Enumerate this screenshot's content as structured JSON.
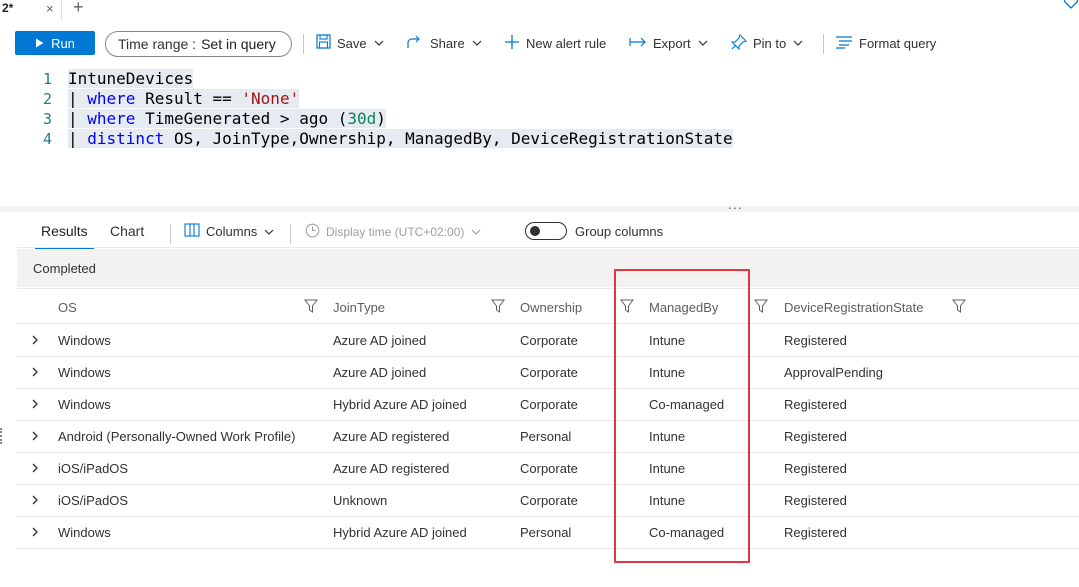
{
  "tab": {
    "title": "2*",
    "close_glyph": "×",
    "add_glyph": "+"
  },
  "toolbar": {
    "run_label": "Run",
    "time_range_label": "Time range :",
    "time_range_value": "Set in query",
    "save_label": "Save",
    "share_label": "Share",
    "new_alert_label": "New alert rule",
    "export_label": "Export",
    "pin_label": "Pin to",
    "format_label": "Format query"
  },
  "editor": {
    "line_numbers": [
      "1",
      "2",
      "3",
      "4"
    ],
    "lines": [
      {
        "t1": "IntuneDevices"
      },
      {
        "pipe": "| ",
        "kw": "where",
        "mid": " Result == ",
        "str": "'None'"
      },
      {
        "pipe": "| ",
        "kw": "where",
        "mid": " TimeGenerated > ago (",
        "num": "30d",
        "end": ")"
      },
      {
        "pipe": "| ",
        "kw": "distinct",
        "mid": " OS, JoinType,Ownership, ManagedBy, DeviceRegistrationState"
      }
    ],
    "splitter_glyph": "..."
  },
  "results": {
    "tabs": [
      "Results",
      "Chart"
    ],
    "columns_label": "Columns",
    "display_time_label": "Display time (UTC+02:00)",
    "group_columns_label": "Group columns",
    "status": "Completed"
  },
  "grid": {
    "columns": [
      "OS",
      "JoinType",
      "Ownership",
      "ManagedBy",
      "DeviceRegistrationState"
    ],
    "rows": [
      [
        "Windows",
        "Azure AD joined",
        "Corporate",
        "Intune",
        "Registered"
      ],
      [
        "Windows",
        "Azure AD joined",
        "Corporate",
        "Intune",
        "ApprovalPending"
      ],
      [
        "Windows",
        "Hybrid Azure AD joined",
        "Corporate",
        "Co-managed",
        "Registered"
      ],
      [
        "Android (Personally-Owned Work Profile)",
        "Azure AD registered",
        "Personal",
        "Intune",
        "Registered"
      ],
      [
        "iOS/iPadOS",
        "Azure AD registered",
        "Corporate",
        "Intune",
        "Registered"
      ],
      [
        "iOS/iPadOS",
        "Unknown",
        "Corporate",
        "Intune",
        "Registered"
      ],
      [
        "Windows",
        "Hybrid Azure AD joined",
        "Personal",
        "Co-managed",
        "Registered"
      ]
    ]
  },
  "colors": {
    "accent": "#0078d4",
    "highlight_box": "#e2353f",
    "keyword": "#0000ff",
    "string": "#a31515",
    "number": "#098658"
  },
  "icons": [
    "close-icon",
    "plus-icon",
    "heart-icon",
    "play-icon",
    "save-icon",
    "share-icon",
    "plus-icon",
    "export-icon",
    "pin-icon",
    "format-icon",
    "columns-icon",
    "clock-icon",
    "filter-icon",
    "chevron-right-icon",
    "chevron-down-icon"
  ]
}
